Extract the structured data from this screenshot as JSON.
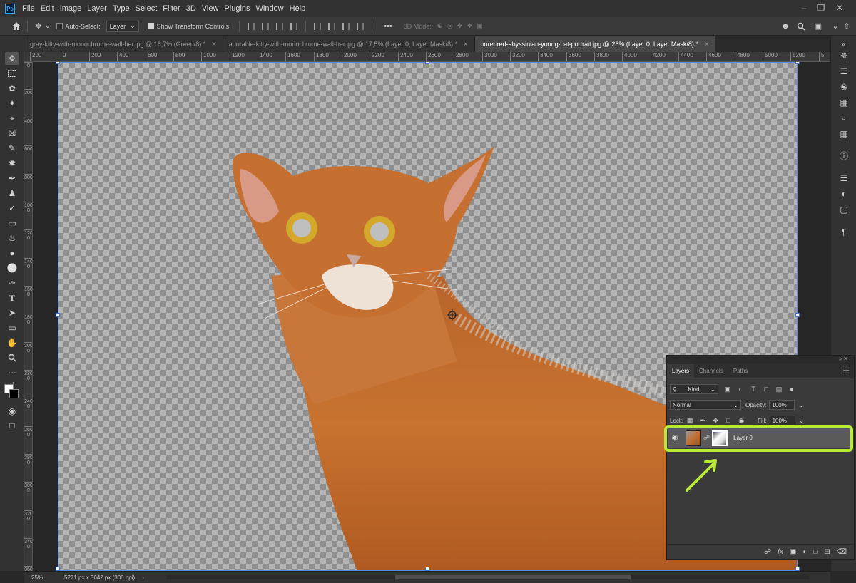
{
  "app": {
    "logo_text": "Ps"
  },
  "menubar": {
    "items": [
      "File",
      "Edit",
      "Image",
      "Layer",
      "Type",
      "Select",
      "Filter",
      "3D",
      "View",
      "Plugins",
      "Window",
      "Help"
    ]
  },
  "options_bar": {
    "auto_select_label": "Auto-Select:",
    "auto_select_value": "Layer",
    "show_transform_label": "Show Transform Controls",
    "more_label": "•••",
    "mode_3d_label": "3D Mode:"
  },
  "tabs": [
    {
      "title": "gray-kitty-with-monochrome-wall-her.jpg @ 16,7% (Green/8) *",
      "active": false
    },
    {
      "title": "adorable-kitty-with-monochrome-wall-her.jpg @ 17,5% (Layer 0, Layer Mask/8) *",
      "active": false
    },
    {
      "title": "purebred-abyssinian-young-cat-portrait.jpg @ 25% (Layer 0, Layer Mask/8) *",
      "active": true
    }
  ],
  "ruler": {
    "h_ticks": [
      "200",
      "0",
      "200",
      "400",
      "600",
      "800",
      "1000",
      "1200",
      "1400",
      "1600",
      "1800",
      "2000",
      "2200",
      "2400",
      "2600",
      "2800",
      "3000",
      "3200",
      "3400",
      "3600",
      "3800",
      "4000",
      "4200",
      "4400",
      "4600",
      "4800",
      "5000",
      "5200",
      "5"
    ],
    "v_ticks": [
      "0",
      "200",
      "400",
      "600",
      "800",
      "1000",
      "1200",
      "1400",
      "1600",
      "1800",
      "2000",
      "2200",
      "2400",
      "2600",
      "2800",
      "3000",
      "3200",
      "3400",
      "3600"
    ]
  },
  "layers_panel": {
    "tabs": [
      "Layers",
      "Channels",
      "Paths"
    ],
    "filter_kind": "Kind",
    "blend_mode": "Normal",
    "opacity_label": "Opacity:",
    "opacity_value": "100%",
    "lock_label": "Lock:",
    "fill_label": "Fill:",
    "fill_value": "100%",
    "layer_name": "Layer 0",
    "bottom_icons": [
      "link-icon",
      "fx-icon",
      "mask-icon",
      "adjustment-icon",
      "folder-icon",
      "new-layer-icon",
      "trash-icon"
    ]
  },
  "status": {
    "zoom": "25%",
    "doc_info": "5271 px x 3642 px (300 ppi)"
  },
  "colors": {
    "highlight": "#b6ea35",
    "cat_orange": "#c86a2a",
    "selection_blue": "#3a6fd8"
  }
}
